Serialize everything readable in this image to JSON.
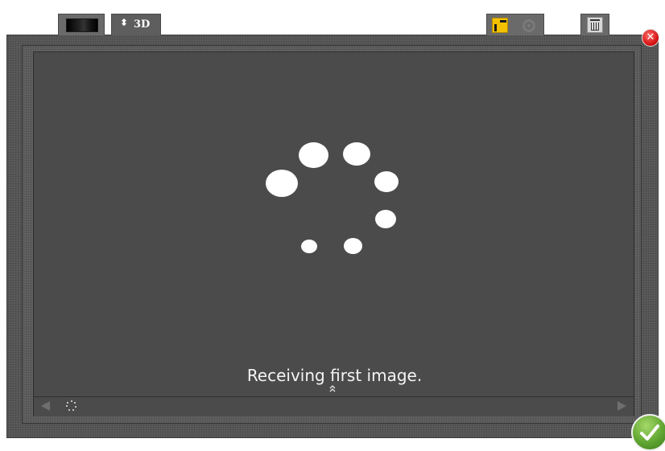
{
  "tabs": {
    "view2d": {
      "icon": "image-thumbnail-icon"
    },
    "view3d": {
      "icon": "up-down-arrows-icon",
      "label": "3D"
    }
  },
  "toolbar": {
    "panel_icon": "panel-layout-icon",
    "rotate_icon": "rotate-icon",
    "trash_icon": "trash-icon",
    "accent_color": "#f2c200"
  },
  "window": {
    "close_icon": "close-icon",
    "close_glyph": "✕",
    "close_color": "#d81818"
  },
  "viewport": {
    "status_text": "Receiving first image.",
    "spinner_icon": "loading-spinner-icon",
    "expand_icon": "double-chevron-up-icon",
    "expand_glyph": "⌃"
  },
  "navigation": {
    "prev_icon": "arrow-left-icon",
    "next_icon": "arrow-right-icon",
    "mini_spinner_icon": "mini-loading-spinner-icon"
  },
  "confirm": {
    "icon": "checkmark-icon",
    "color": "#5fa531"
  }
}
